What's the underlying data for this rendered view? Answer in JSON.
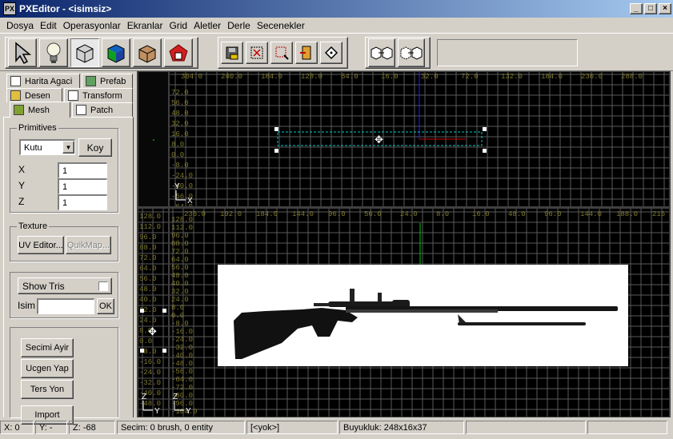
{
  "window": {
    "title": "PXEditor - <isimsiz>",
    "app_icon": "px-icon"
  },
  "menu": [
    "Dosya",
    "Edit",
    "Operasyonlar",
    "Ekranlar",
    "Grid",
    "Aletler",
    "Derle",
    "Secenekler"
  ],
  "tabs": {
    "row1": [
      "Harita Agaci",
      "Prefab"
    ],
    "row2": [
      "Desen",
      "Transform"
    ],
    "row3": [
      "Mesh",
      "Patch"
    ],
    "active": "Mesh"
  },
  "primitives": {
    "label": "Primitives",
    "selected": "Kutu",
    "add_button": "Koy",
    "x_label": "X",
    "x_value": "1",
    "y_label": "Y",
    "y_value": "1",
    "z_label": "Z",
    "z_value": "1"
  },
  "texture": {
    "label": "Texture",
    "uv_editor": "UV Editor...",
    "quickmap": "QuikMap..."
  },
  "tris": {
    "show_tris": "Show Tris",
    "name_label": "Isim",
    "name_value": "",
    "ok": "OK"
  },
  "actions": {
    "split": "Secimi Ayir",
    "face": "Ucgen Yap",
    "reverse": "Ters Yon",
    "import": "Import"
  },
  "viewports": {
    "top_ruler": [
      "304.0",
      "240.0",
      "184.0",
      "128.0",
      "64.0",
      "16.0",
      "32.0",
      "72.0",
      "132.0",
      "184.0",
      "236.0",
      "288.0"
    ],
    "top_left_ruler": [
      "72.0",
      "56.0",
      "48.0",
      "32.0",
      "16.0",
      "8.0",
      "0.0",
      "-8.0",
      "-24.0",
      "-40.0",
      "-56.0",
      "-64.0"
    ],
    "bottom_ruler": [
      "236.0",
      "192.0",
      "184.0",
      "144.0",
      "96.0",
      "56.0",
      "24.0",
      "8.0",
      "16.0",
      "48.0",
      "96.0",
      "144.0",
      "188.0",
      "216"
    ],
    "bottom_left_ruler": [
      "128.0",
      "112.0",
      "96.0",
      "88.0",
      "72.0",
      "64.0",
      "56.0",
      "48.0",
      "40.0",
      "32.0",
      "24.0",
      "8.0",
      "0.0",
      "-8.0",
      "-16.0",
      "-24.0",
      "-32.0",
      "-40.0",
      "-48.0",
      "-56.0",
      "-64.0",
      "-72.0",
      "-80.0",
      "-96.0",
      "-104.0"
    ],
    "axis_x": "X",
    "axis_y": "Y",
    "axis_z": "Z"
  },
  "status": {
    "x": "X: 0",
    "y": "Y: -",
    "z": "Z: -68",
    "selection": "Secim: 0 brush, 0 entity",
    "entity": "[<yok>]",
    "size": "Buyukluk: 248x16x37"
  },
  "colors": {
    "grid_line": "#5a5a5a",
    "grid_major": "#7a7a7a",
    "ruler": "#807a30",
    "selection": "#00c8c8",
    "axis_green": "#00c800",
    "axis_blue": "#2020ff",
    "axis_red": "#c80000"
  }
}
